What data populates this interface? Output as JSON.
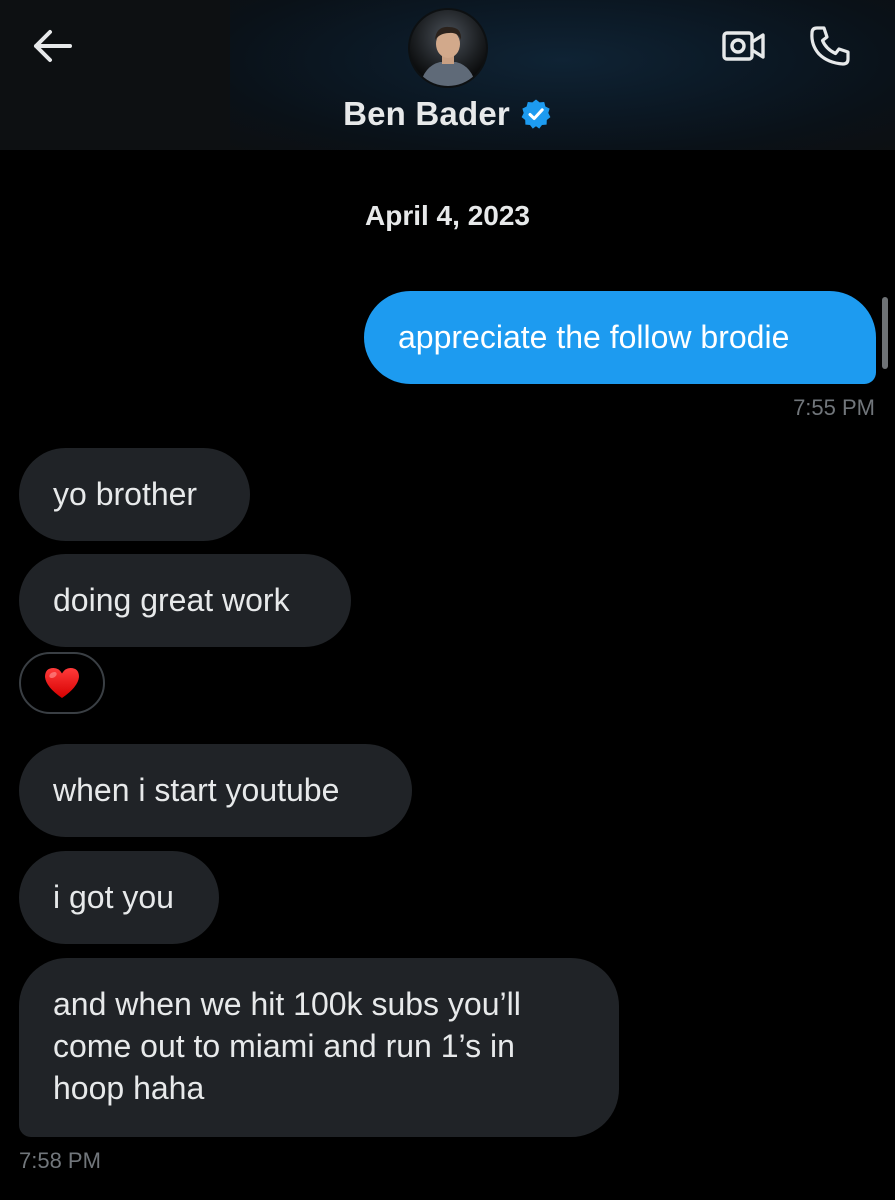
{
  "header": {
    "contact_name": "Ben Bader",
    "icons": {
      "back": "arrow-left-icon",
      "verified": "verified-badge-icon",
      "video": "video-call-icon",
      "call": "phone-icon"
    }
  },
  "conversation": {
    "date_separator": "April 4, 2023",
    "messages": [
      {
        "direction": "sent",
        "text": "appreciate the follow brodie"
      },
      {
        "direction": "received",
        "text": "yo brother"
      },
      {
        "direction": "received",
        "text": "doing great work"
      },
      {
        "direction": "received",
        "text": "when i start youtube"
      },
      {
        "direction": "received",
        "text": "i got you"
      },
      {
        "direction": "received",
        "text": "and when we hit 100k subs you’ll come out to miami and run 1’s in hoop haha"
      }
    ],
    "sent_time": "7:55 PM",
    "received_time": "7:58 PM",
    "reaction": "heart-emoji"
  },
  "colors": {
    "background": "#000000",
    "sent_bubble": "#1d9bf0",
    "received_bubble": "#202327",
    "verified_badge": "#1d9bf0",
    "timestamp": "#71767b"
  }
}
